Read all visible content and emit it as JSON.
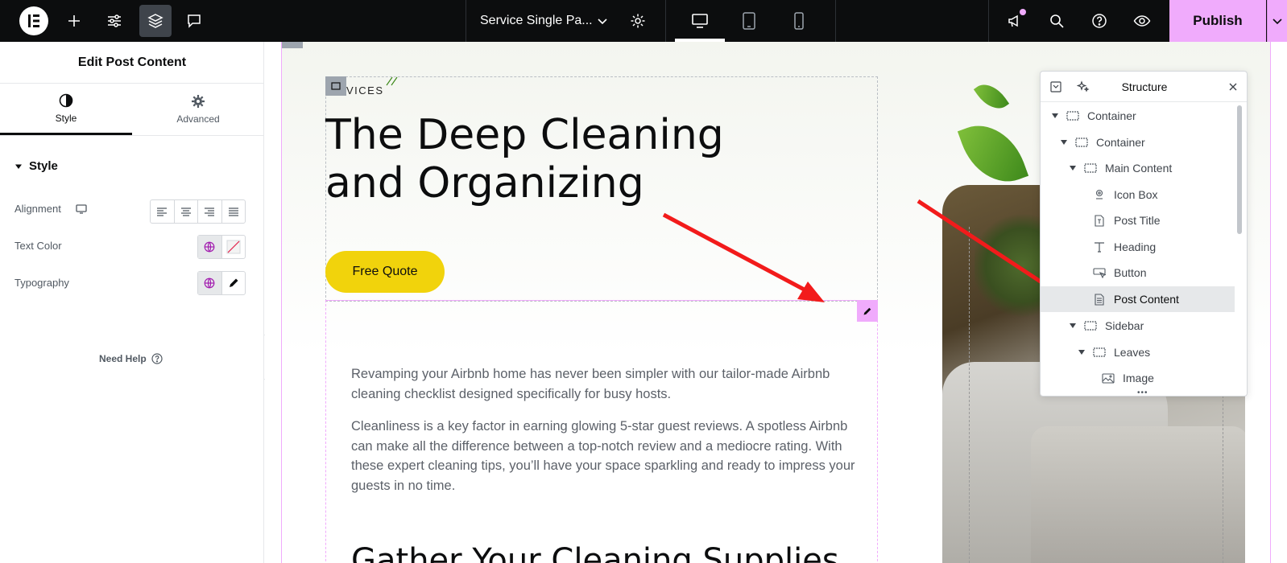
{
  "topbar": {
    "document_title": "Service Single Pa...",
    "publish_label": "Publish",
    "icons": [
      "elementor-logo-icon",
      "plus-icon",
      "sliders-icon",
      "layers-icon",
      "chat-icon",
      "chevron-down-icon",
      "gear-icon",
      "desktop-icon",
      "tablet-icon",
      "mobile-icon",
      "megaphone-icon",
      "search-icon",
      "help-icon",
      "eye-icon"
    ],
    "accent": "#f0abfc"
  },
  "panel": {
    "title": "Edit Post Content",
    "tabs": [
      {
        "label": "Style",
        "active": true
      },
      {
        "label": "Advanced",
        "active": false
      }
    ],
    "section_title": "Style",
    "controls": {
      "alignment_label": "Alignment",
      "text_color_label": "Text Color",
      "typography_label": "Typography"
    },
    "need_help_label": "Need Help"
  },
  "canvas": {
    "eyebrow": "VICES",
    "post_title": "The Deep Cleaning and Organizing",
    "button_label": "Free Quote",
    "button_color": "#f1d30c",
    "paragraphs": [
      "Revamping your Airbnb home has never been simpler with our tailor-made Airbnb cleaning checklist designed specifically for busy hosts.",
      "Cleanliness is a key factor in earning glowing 5-star guest reviews. A spotless Airbnb can make all the difference between a top-notch review and a mediocre rating. With these expert cleaning tips, you’ll have your space sparkling and ready to impress your guests in no time."
    ],
    "content_heading": "Gather Your Cleaning Supplies"
  },
  "structure": {
    "title": "Structure",
    "items": [
      {
        "label": "Container",
        "icon": "container-icon",
        "level": 0,
        "caret": true,
        "selected": false
      },
      {
        "label": "Container",
        "icon": "container-icon",
        "level": 1,
        "caret": true,
        "selected": false
      },
      {
        "label": "Main Content",
        "icon": "container-icon",
        "level": 2,
        "caret": true,
        "selected": false
      },
      {
        "label": "Icon Box",
        "icon": "icon-box-icon",
        "level": 3,
        "caret": false,
        "selected": false
      },
      {
        "label": "Post Title",
        "icon": "post-title-icon",
        "level": 3,
        "caret": false,
        "selected": false
      },
      {
        "label": "Heading",
        "icon": "heading-icon",
        "level": 3,
        "caret": false,
        "selected": false
      },
      {
        "label": "Button",
        "icon": "button-icon",
        "level": 3,
        "caret": false,
        "selected": false
      },
      {
        "label": "Post Content",
        "icon": "post-content-icon",
        "level": 3,
        "caret": false,
        "selected": true
      },
      {
        "label": "Sidebar",
        "icon": "container-icon",
        "level": 2,
        "caret": true,
        "selected": false
      },
      {
        "label": "Leaves",
        "icon": "container-icon",
        "level": 3,
        "caret": true,
        "selected": false
      },
      {
        "label": "Image",
        "icon": "image-icon",
        "level": 4,
        "caret": false,
        "selected": false
      }
    ]
  }
}
